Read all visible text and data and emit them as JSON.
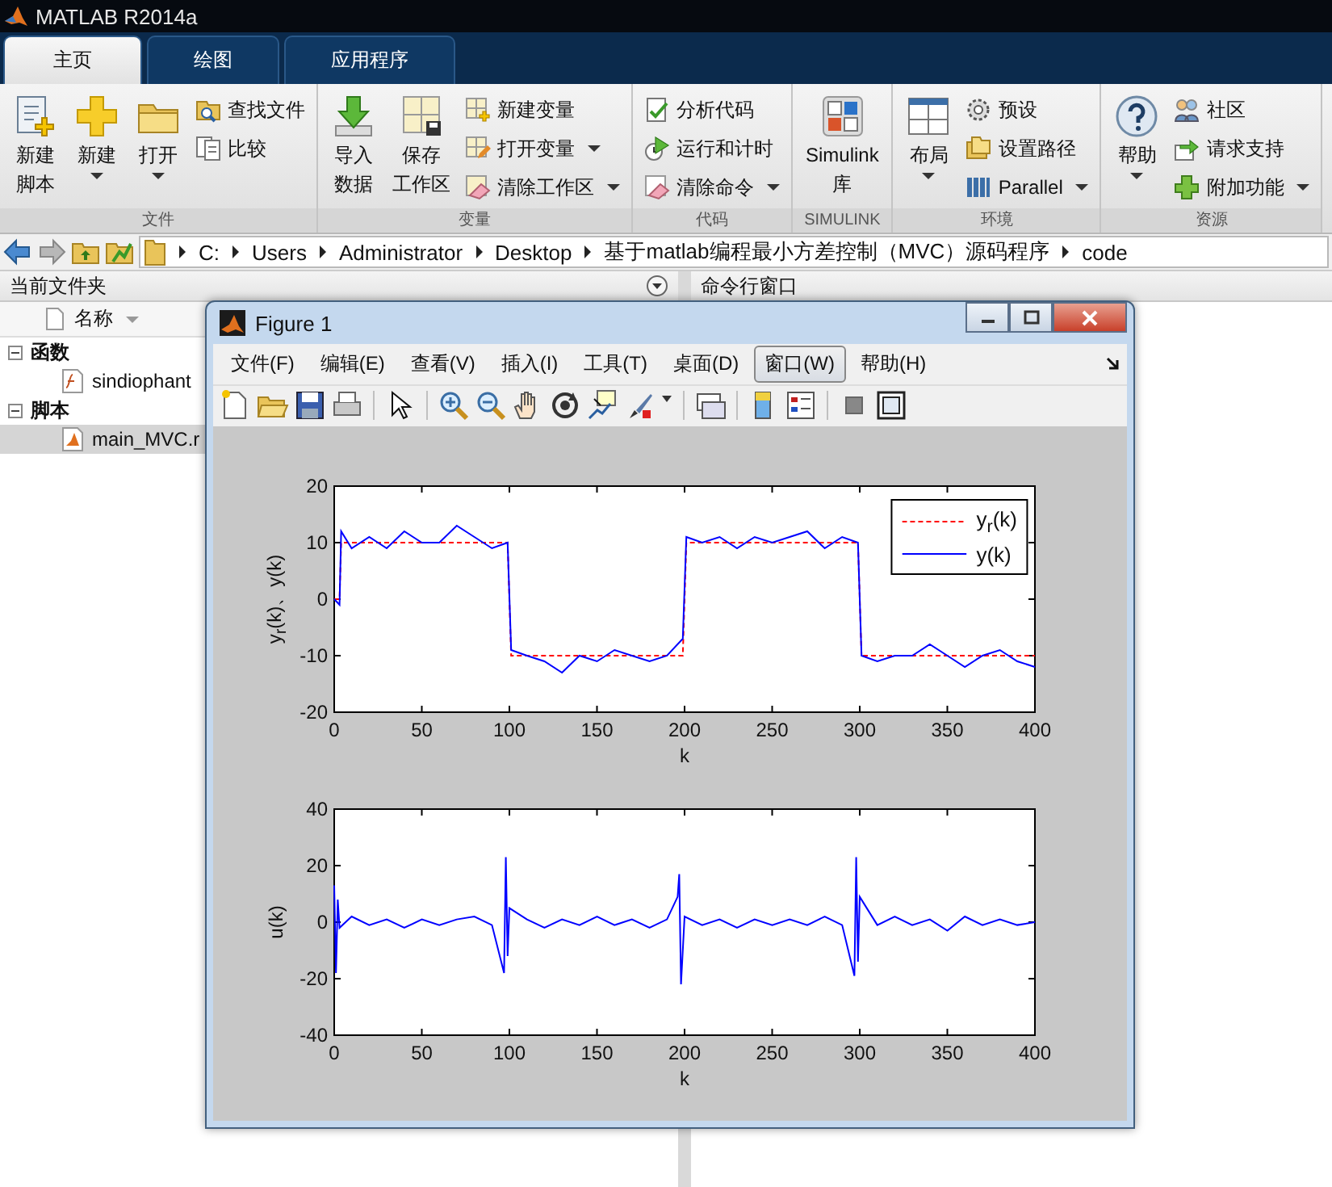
{
  "window": {
    "title": "MATLAB R2014a"
  },
  "tabs": [
    {
      "label": "主页",
      "selected": true
    },
    {
      "label": "绘图",
      "selected": false
    },
    {
      "label": "应用程序",
      "selected": false
    }
  ],
  "toolstrip": [
    {
      "label": "文件",
      "items": [
        {
          "kind": "large",
          "label": [
            "新建",
            "脚本"
          ],
          "dropdown": false
        },
        {
          "kind": "large",
          "label": [
            "新建"
          ],
          "dropdown": true
        },
        {
          "kind": "large",
          "label": [
            "打开"
          ],
          "dropdown": true
        },
        {
          "kind": "stack",
          "entries": [
            {
              "label": "查找文件",
              "dropdown": false
            },
            {
              "label": "比较",
              "dropdown": false
            }
          ]
        }
      ]
    },
    {
      "label": "变量",
      "items": [
        {
          "kind": "large",
          "label": [
            "导入",
            "数据"
          ],
          "dropdown": false
        },
        {
          "kind": "large",
          "label": [
            "保存",
            "工作区"
          ],
          "dropdown": false
        },
        {
          "kind": "stack",
          "entries": [
            {
              "label": "新建变量",
              "dropdown": false
            },
            {
              "label": "打开变量",
              "dropdown": true
            },
            {
              "label": "清除工作区",
              "dropdown": true
            }
          ]
        }
      ]
    },
    {
      "label": "代码",
      "items": [
        {
          "kind": "stack",
          "entries": [
            {
              "label": "分析代码",
              "dropdown": false
            },
            {
              "label": "运行和计时",
              "dropdown": false
            },
            {
              "label": "清除命令",
              "dropdown": true
            }
          ]
        }
      ]
    },
    {
      "label": "SIMULINK",
      "items": [
        {
          "kind": "large",
          "label": [
            "Simulink",
            "库"
          ],
          "dropdown": false
        }
      ]
    },
    {
      "label": "环境",
      "items": [
        {
          "kind": "large",
          "label": [
            "布局"
          ],
          "dropdown": true
        },
        {
          "kind": "stack",
          "entries": [
            {
              "label": "预设",
              "dropdown": false
            },
            {
              "label": "设置路径",
              "dropdown": false
            },
            {
              "label": "Parallel",
              "dropdown": true
            }
          ]
        }
      ]
    },
    {
      "label": "资源",
      "items": [
        {
          "kind": "large",
          "label": [
            "帮助"
          ],
          "dropdown": true
        },
        {
          "kind": "stack",
          "entries": [
            {
              "label": "社区",
              "dropdown": false
            },
            {
              "label": "请求支持",
              "dropdown": false
            },
            {
              "label": "附加功能",
              "dropdown": true
            }
          ]
        }
      ]
    }
  ],
  "address_bar": {
    "path": [
      "C:",
      "Users",
      "Administrator",
      "Desktop",
      "基于matlab编程最小方差控制（MVC）源码程序",
      "code"
    ]
  },
  "current_folder": {
    "title": "当前文件夹",
    "column": "名称",
    "tree": [
      {
        "label": "函数",
        "expanded": true,
        "children": [
          {
            "label": "sindiophant",
            "selected": false
          }
        ]
      },
      {
        "label": "脚本",
        "expanded": true,
        "children": [
          {
            "label": "main_MVC.r",
            "selected": true
          }
        ]
      }
    ]
  },
  "command_window": {
    "title": "命令行窗口"
  },
  "figure": {
    "title": "Figure 1",
    "menu": [
      {
        "label": "文件(F)",
        "selected": false
      },
      {
        "label": "编辑(E)",
        "selected": false
      },
      {
        "label": "查看(V)",
        "selected": false
      },
      {
        "label": "插入(I)",
        "selected": false
      },
      {
        "label": "工具(T)",
        "selected": false
      },
      {
        "label": "桌面(D)",
        "selected": false
      },
      {
        "label": "窗口(W)",
        "selected": true
      },
      {
        "label": "帮助(H)",
        "selected": false
      }
    ],
    "axes": [
      {
        "chart_data": {
          "type": "line",
          "xlabel": "k",
          "ylabel": "y$_{r}$(k)、y(k)",
          "legend": true,
          "x": [
            0,
            3,
            4,
            10,
            20,
            30,
            40,
            50,
            60,
            70,
            80,
            90,
            99,
            101,
            110,
            120,
            130,
            140,
            150,
            160,
            170,
            180,
            190,
            199,
            201,
            210,
            220,
            230,
            240,
            250,
            260,
            270,
            280,
            290,
            299,
            301,
            310,
            320,
            330,
            340,
            350,
            360,
            370,
            380,
            390,
            400
          ],
          "series": [
            {
              "name": "y$_{r}$(k)",
              "color": "#ff0000",
              "line_style": "dashed",
              "values": [
                0,
                0,
                10,
                10,
                10,
                10,
                10,
                10,
                10,
                10,
                10,
                10,
                10,
                -10,
                -10,
                -10,
                -10,
                -10,
                -10,
                -10,
                -10,
                -10,
                -10,
                -10,
                10,
                10,
                10,
                10,
                10,
                10,
                10,
                10,
                10,
                10,
                10,
                -10,
                -10,
                -10,
                -10,
                -10,
                -10,
                -10,
                -10,
                -10,
                -10,
                -10
              ]
            },
            {
              "name": "y(k)",
              "color": "#0000ff",
              "line_style": "solid",
              "values": [
                0,
                -1,
                12,
                9,
                11,
                9,
                12,
                10,
                10,
                13,
                11,
                9,
                10,
                -9,
                -10,
                -11,
                -13,
                -10,
                -11,
                -9,
                -10,
                -11,
                -10,
                -7,
                11,
                10,
                11,
                9,
                11,
                10,
                11,
                12,
                9,
                11,
                10,
                -10,
                -11,
                -10,
                -10,
                -8,
                -10,
                -12,
                -10,
                -9,
                -11,
                -12
              ]
            }
          ],
          "xlim": [
            0,
            400
          ],
          "ylim": [
            -20,
            20
          ],
          "xticks": [
            0,
            50,
            100,
            150,
            200,
            250,
            300,
            350,
            400
          ],
          "yticks": [
            -20,
            -10,
            0,
            10,
            20
          ]
        }
      },
      {
        "chart_data": {
          "type": "line",
          "xlabel": "k",
          "ylabel": "u(k)",
          "x": [
            0,
            1,
            2,
            3,
            10,
            20,
            30,
            40,
            50,
            60,
            70,
            80,
            90,
            97,
            98,
            99,
            100,
            110,
            120,
            130,
            140,
            150,
            160,
            170,
            180,
            190,
            196,
            197,
            198,
            200,
            210,
            220,
            230,
            240,
            250,
            260,
            270,
            280,
            290,
            297,
            298,
            299,
            300,
            310,
            320,
            330,
            340,
            350,
            360,
            370,
            380,
            390,
            400
          ],
          "series": [
            {
              "color": "#0000ff",
              "line_style": "solid",
              "values": [
                13,
                -18,
                8,
                -2,
                2,
                -1,
                1,
                -2,
                1,
                -1,
                1,
                2,
                -1,
                -18,
                23,
                -12,
                5,
                1,
                -2,
                1,
                -1,
                2,
                -1,
                1,
                -2,
                1,
                9,
                17,
                -22,
                2,
                -1,
                1,
                -2,
                1,
                -1,
                1,
                -1,
                2,
                -1,
                -19,
                23,
                -14,
                9,
                -1,
                2,
                -1,
                1,
                -3,
                2,
                -1,
                1,
                -1,
                0
              ]
            }
          ],
          "xlim": [
            0,
            400
          ],
          "ylim": [
            -40,
            40
          ],
          "xticks": [
            0,
            50,
            100,
            150,
            200,
            250,
            300,
            350,
            400
          ],
          "yticks": [
            -40,
            -20,
            0,
            20,
            40
          ]
        }
      }
    ]
  }
}
